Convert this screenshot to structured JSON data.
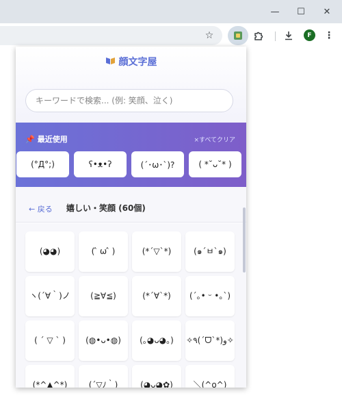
{
  "window": {
    "minimize_glyph": "—",
    "maximize_glyph": "☐",
    "close_glyph": "✕"
  },
  "toolbar": {
    "star_icon": "☆",
    "extensions_icon": "⧉",
    "download_icon": "⤓",
    "menu_icon": "⋮",
    "profile_initial": "F"
  },
  "popup": {
    "title": "顔文字屋",
    "search_placeholder": "キーワードで検索... (例: 笑顔、泣く)",
    "recent": {
      "title": "最近使用",
      "clear_label": "×すべてクリア",
      "items": [
        "(°Д°;)",
        "ʕ•ᴥ•ʔ",
        "(´･ω･`)?",
        "( *˘ᴗ˘* )"
      ]
    },
    "nav": {
      "back_label": "← 戻る",
      "category_title": "嬉しい・笑顔 (60個)"
    },
    "kaomoji": [
      "(◕◕)",
      "( ̂ ω ̂ )",
      "(*´▽`*)",
      "(๑´ㅂ`๑)",
      "ヽ(´∀｀)ノ",
      "(≧∀≦)",
      "(*´∀`*)",
      "(´｡• ᵕ •｡`)",
      "( ´ ▽ ` )",
      "(◍•ᴗ•◍)",
      "(｡◕ᴗ◕｡)",
      "✧٩(ˊᗜˋ*)و✧",
      "(*^▲^*)",
      "(´▽ﾉ｀)",
      "(◕ᴗ◕✿)",
      "＼(^o^)"
    ]
  },
  "colors": {
    "accent": "#5b6fd6",
    "recent_gradient_start": "#6b72d8",
    "recent_gradient_end": "#7e5ec9",
    "profile": "#1b6e25"
  }
}
